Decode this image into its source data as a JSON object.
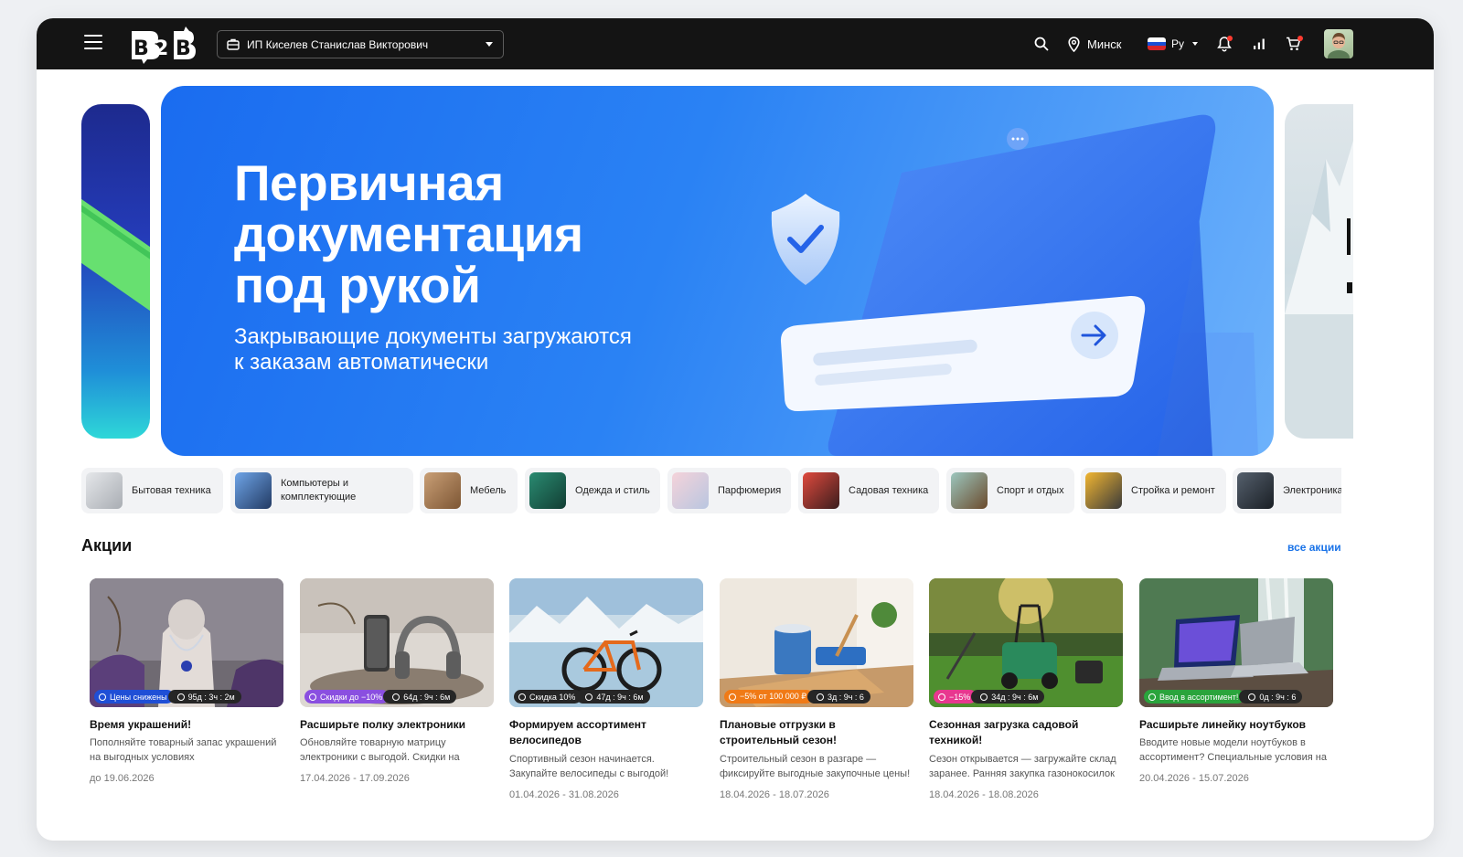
{
  "header": {
    "company": "ИП Киселев Станислав Викторович",
    "city": "Минск",
    "lang": "Ру",
    "logo_text": "B2B"
  },
  "banner": {
    "title_lines": [
      "Первичная",
      "документация",
      "под рукой"
    ],
    "subtitle_lines": [
      "Закрывающие документы загружаются",
      "к заказам автоматически"
    ]
  },
  "categories": [
    {
      "label": "Бытовая техника",
      "color": "#c9ccd2"
    },
    {
      "label": "Компьютеры и комплектующие",
      "color": "#5a8fd6"
    },
    {
      "label": "Мебель",
      "color": "#b58a63"
    },
    {
      "label": "Одежда и стиль",
      "color": "#1d6b58"
    },
    {
      "label": "Парфюмерия",
      "color": "#e8b9c4"
    },
    {
      "label": "Садовая техника",
      "color": "#c8342e"
    },
    {
      "label": "Спорт и отдых",
      "color": "#7aa7a0"
    },
    {
      "label": "Стройка и ремонт",
      "color": "#d49a1f"
    },
    {
      "label": "Электроника",
      "color": "#2e3640"
    }
  ],
  "promos": {
    "title": "Акции",
    "all_link": "все акции",
    "items": [
      {
        "badge": "Цены снижены",
        "badge_color": "#1f4fd6",
        "timer": "95д : 3ч : 2м",
        "title": "Время украшений!",
        "desc": "Пополняйте товарный запас украшений на выгодных условиях",
        "dates": "до 19.06.2026"
      },
      {
        "badge": "Скидки до −10%",
        "badge_color": "#8a4fe0",
        "timer": "64д : 9ч : 6м",
        "title": "Расширьте полку электроники",
        "desc": "Обновляйте товарную матрицу электроники с выгодой. Скидки на",
        "dates": "17.04.2026 - 17.09.2026"
      },
      {
        "badge": "Скидка 10%",
        "badge_color": "#262626",
        "timer": "47д : 9ч : 6м",
        "title": "Формируем ассортимент велосипедов",
        "desc": "Спортивный сезон начинается. Закупайте велосипеды с выгодой!",
        "dates": "01.04.2026 - 31.08.2026"
      },
      {
        "badge": "−5% от 100 000 ₽",
        "badge_color": "#f07a16",
        "timer": "3д : 9ч : 6",
        "title": "Плановые отгрузки в строительный сезон!",
        "desc": "Строительный сезон в разгаре — фиксируйте выгодные закупочные цены!",
        "dates": "18.04.2026 - 18.07.2026"
      },
      {
        "badge": "−15%",
        "badge_color": "#e8378f",
        "timer": "34д : 9ч : 6м",
        "title": "Сезонная загрузка садовой техникой!",
        "desc": "Сезон открывается — загружайте склад заранее. Ранняя закупка газонокосилок",
        "dates": "18.04.2026 - 18.08.2026"
      },
      {
        "badge": "Ввод в ассортимент!",
        "badge_color": "#2aa43c",
        "timer": "0д : 9ч : 6",
        "title": "Расширьте линейку ноутбуков",
        "desc": "Вводите новые модели ноутбуков в ассортимент? Специальные условия на",
        "dates": "20.04.2026 - 15.07.2026"
      }
    ]
  }
}
